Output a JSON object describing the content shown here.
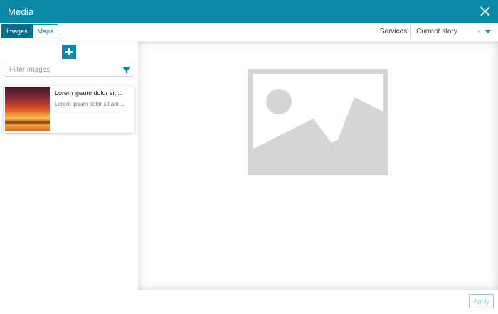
{
  "window": {
    "title": "Media"
  },
  "toolbar": {
    "tabs": [
      {
        "label": "Images",
        "active": true
      },
      {
        "label": "Maps",
        "active": false
      }
    ],
    "services_label": "Services:",
    "services_value": "Current story",
    "services_clear": "×"
  },
  "left_panel": {
    "add_symbol": "+",
    "filter_placeholder": "Filter images",
    "items": [
      {
        "title": "Lorem ipsum dolor sit ...",
        "description": "Lorem ipsum dolor sit ame..."
      }
    ]
  },
  "footer": {
    "apply_label": "Apply"
  },
  "colors": {
    "accent": "#0a88a6",
    "tab_active": "#0a6e8a",
    "placeholder_gray": "#d5d5d5",
    "apply_disabled": "#8ccbd8"
  }
}
